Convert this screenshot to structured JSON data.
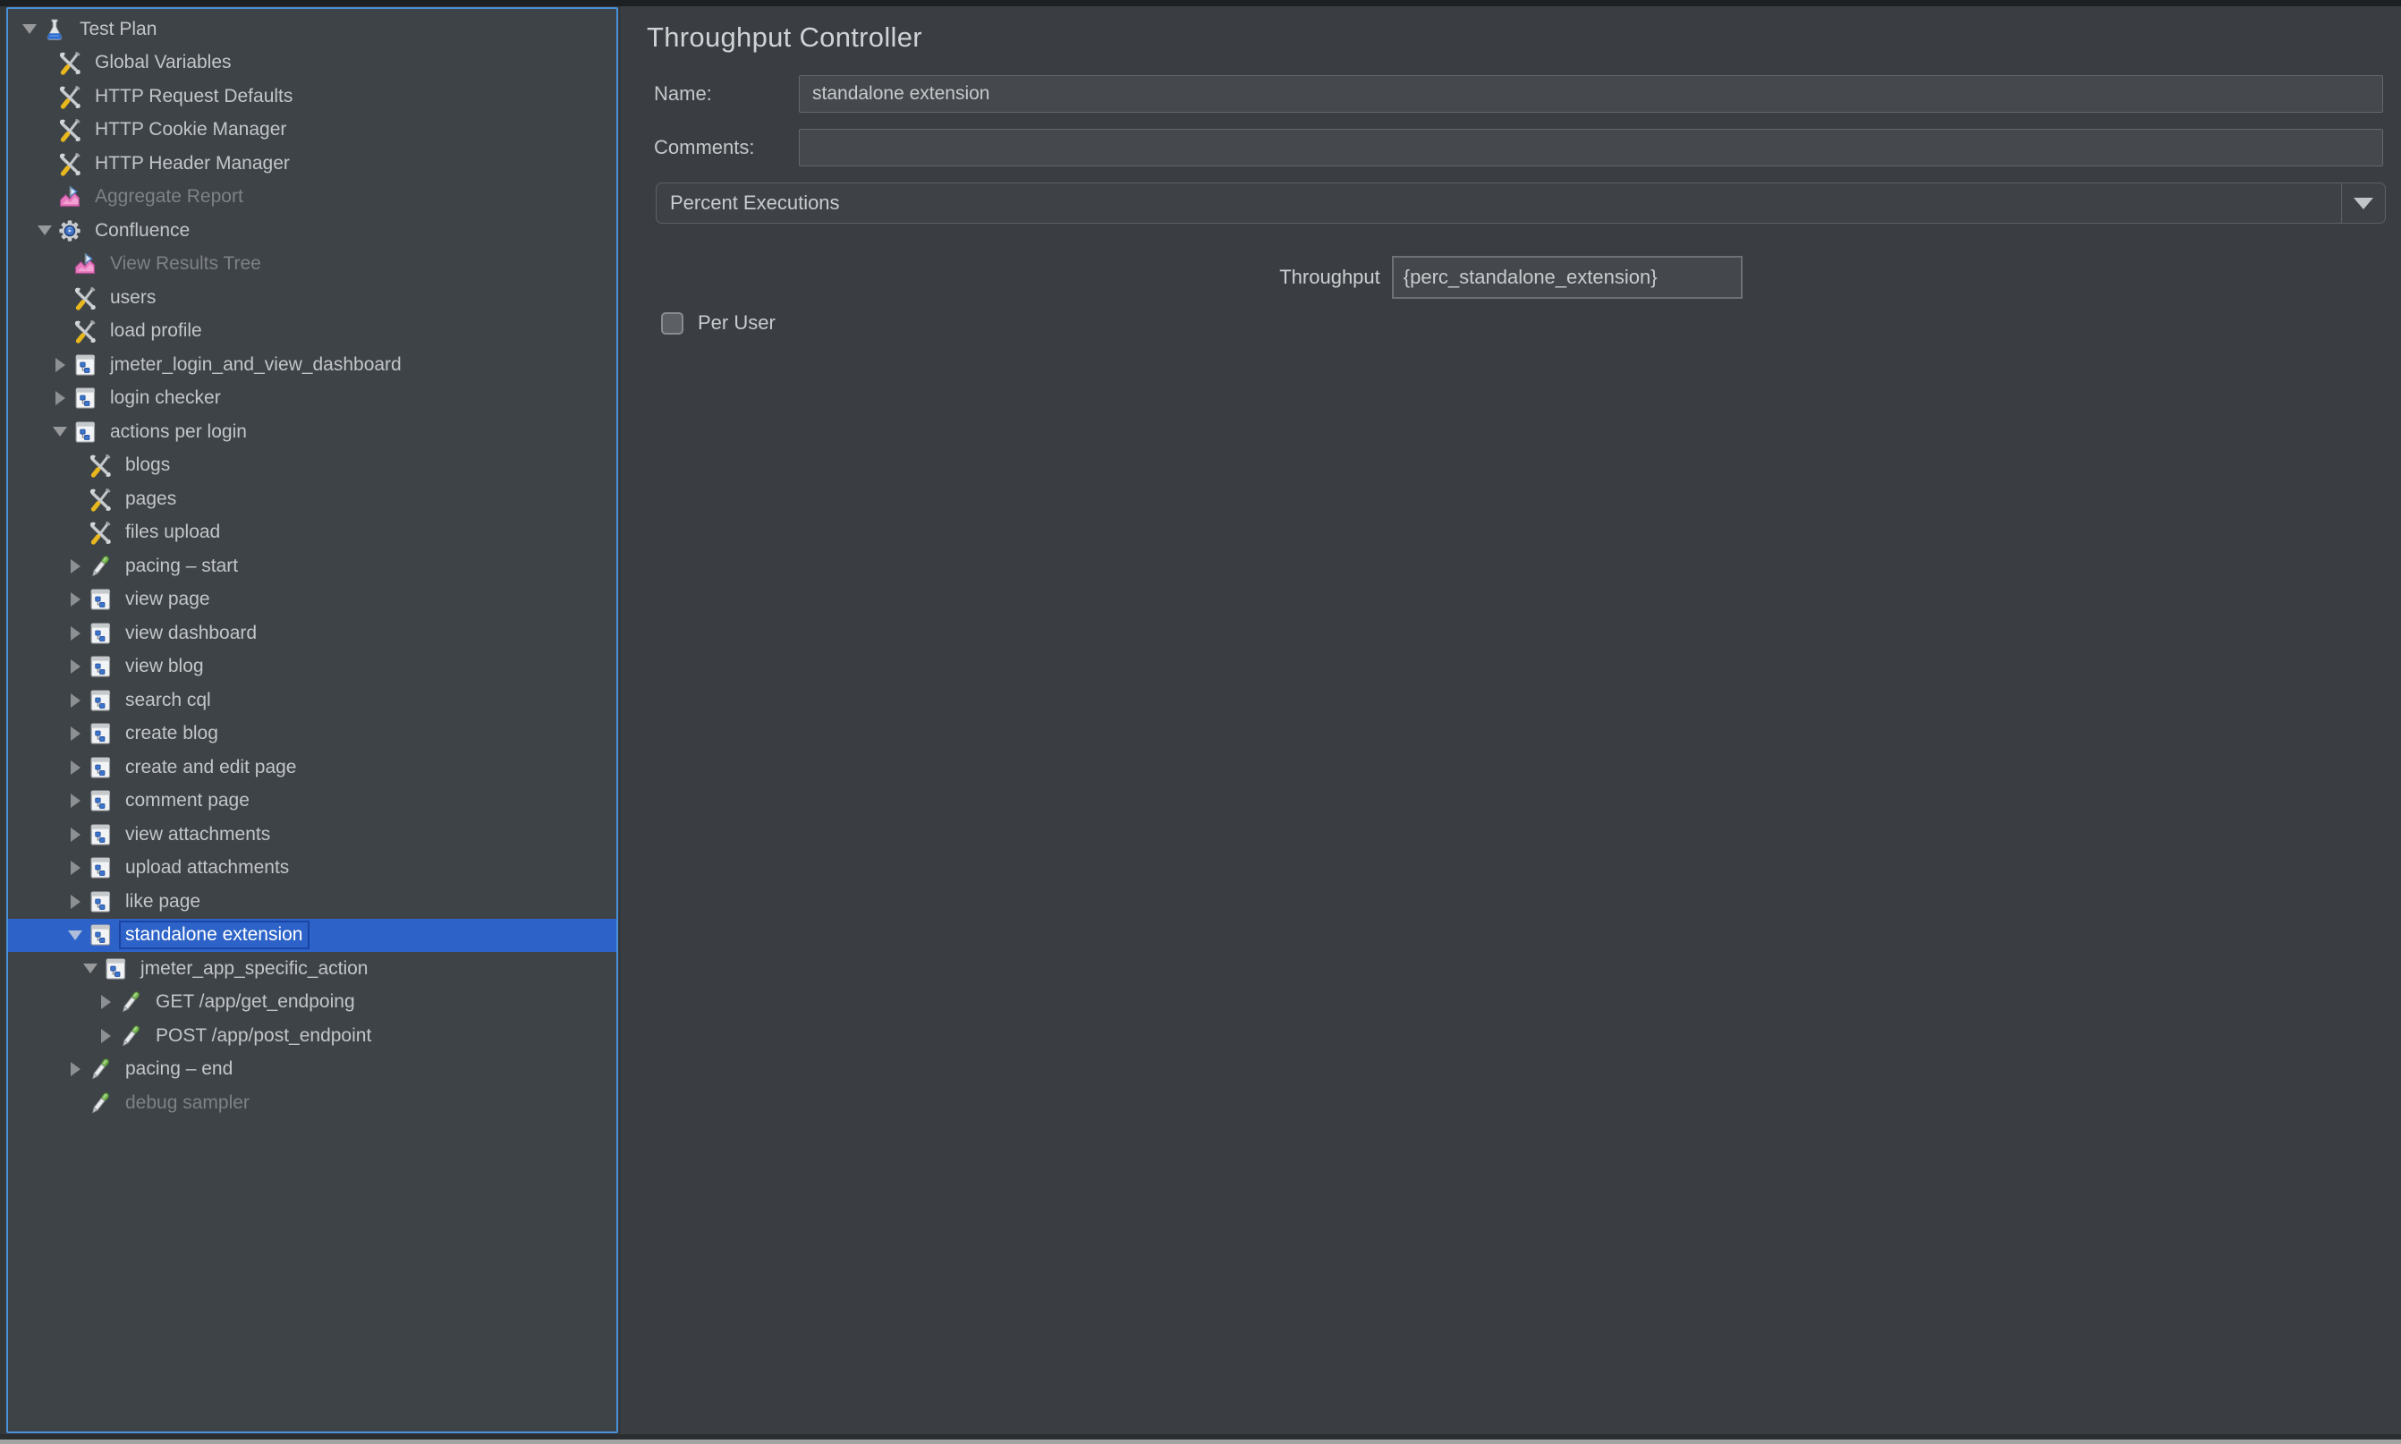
{
  "window": {
    "accent_border_color": "#4a90d8",
    "selection_color": "#2d63c8",
    "panel_background": "#3e4347",
    "editor_background": "#3a3e42"
  },
  "tree": {
    "items": [
      {
        "label": "Test Plan",
        "level": 0,
        "icon": "test-plan-flask-icon",
        "arrow": "expanded"
      },
      {
        "label": "Global Variables",
        "level": 1,
        "icon": "config-wrench-icon",
        "arrow": "none"
      },
      {
        "label": "HTTP Request Defaults",
        "level": 1,
        "icon": "config-wrench-icon",
        "arrow": "none"
      },
      {
        "label": "HTTP Cookie Manager",
        "level": 1,
        "icon": "config-wrench-icon",
        "arrow": "none"
      },
      {
        "label": "HTTP Header Manager",
        "level": 1,
        "icon": "config-wrench-icon",
        "arrow": "none"
      },
      {
        "label": "Aggregate Report",
        "level": 1,
        "icon": "listener-chart-icon",
        "arrow": "none",
        "disabled": true
      },
      {
        "label": "Confluence",
        "level": 1,
        "icon": "thread-group-gear-icon",
        "arrow": "expanded"
      },
      {
        "label": "View Results Tree",
        "level": 2,
        "icon": "listener-chart-icon",
        "arrow": "none",
        "disabled": true
      },
      {
        "label": "users",
        "level": 2,
        "icon": "config-wrench-icon",
        "arrow": "none"
      },
      {
        "label": "load profile",
        "level": 2,
        "icon": "config-wrench-icon",
        "arrow": "none"
      },
      {
        "label": "jmeter_login_and_view_dashboard",
        "level": 2,
        "icon": "controller-icon",
        "arrow": "collapsed"
      },
      {
        "label": "login checker",
        "level": 2,
        "icon": "controller-icon",
        "arrow": "collapsed"
      },
      {
        "label": "actions per login",
        "level": 2,
        "icon": "controller-icon",
        "arrow": "expanded"
      },
      {
        "label": "blogs",
        "level": 3,
        "icon": "config-wrench-icon",
        "arrow": "none"
      },
      {
        "label": "pages",
        "level": 3,
        "icon": "config-wrench-icon",
        "arrow": "none"
      },
      {
        "label": "files upload",
        "level": 3,
        "icon": "config-wrench-icon",
        "arrow": "none"
      },
      {
        "label": "pacing – start",
        "level": 3,
        "icon": "sampler-dropper-icon",
        "arrow": "collapsed"
      },
      {
        "label": "view page",
        "level": 3,
        "icon": "controller-icon",
        "arrow": "collapsed"
      },
      {
        "label": "view dashboard",
        "level": 3,
        "icon": "controller-icon",
        "arrow": "collapsed"
      },
      {
        "label": "view blog",
        "level": 3,
        "icon": "controller-icon",
        "arrow": "collapsed"
      },
      {
        "label": "search cql",
        "level": 3,
        "icon": "controller-icon",
        "arrow": "collapsed"
      },
      {
        "label": "create blog",
        "level": 3,
        "icon": "controller-icon",
        "arrow": "collapsed"
      },
      {
        "label": "create and edit page",
        "level": 3,
        "icon": "controller-icon",
        "arrow": "collapsed"
      },
      {
        "label": "comment page",
        "level": 3,
        "icon": "controller-icon",
        "arrow": "collapsed"
      },
      {
        "label": "view attachments",
        "level": 3,
        "icon": "controller-icon",
        "arrow": "collapsed"
      },
      {
        "label": "upload attachments",
        "level": 3,
        "icon": "controller-icon",
        "arrow": "collapsed"
      },
      {
        "label": "like page",
        "level": 3,
        "icon": "controller-icon",
        "arrow": "collapsed"
      },
      {
        "label": "standalone extension",
        "level": 3,
        "icon": "controller-icon",
        "arrow": "expanded",
        "selected": true
      },
      {
        "label": "jmeter_app_specific_action",
        "level": 4,
        "icon": "controller-icon",
        "arrow": "expanded"
      },
      {
        "label": "GET /app/get_endpoing",
        "level": 5,
        "icon": "sampler-dropper-icon",
        "arrow": "collapsed"
      },
      {
        "label": "POST /app/post_endpoint",
        "level": 5,
        "icon": "sampler-dropper-icon",
        "arrow": "collapsed"
      },
      {
        "label": "pacing – end",
        "level": 3,
        "icon": "sampler-dropper-icon",
        "arrow": "collapsed"
      },
      {
        "label": "debug sampler",
        "level": 3,
        "icon": "sampler-dropper-icon",
        "arrow": "none",
        "disabled": true
      }
    ]
  },
  "editor": {
    "title": "Throughput Controller",
    "name_label": "Name:",
    "name_value": "standalone extension",
    "comments_label": "Comments:",
    "comments_value": "",
    "mode_selected": "Percent Executions",
    "throughput_label": "Throughput",
    "throughput_value": "{perc_standalone_extension}",
    "per_user_label": "Per User",
    "per_user_checked": false
  }
}
